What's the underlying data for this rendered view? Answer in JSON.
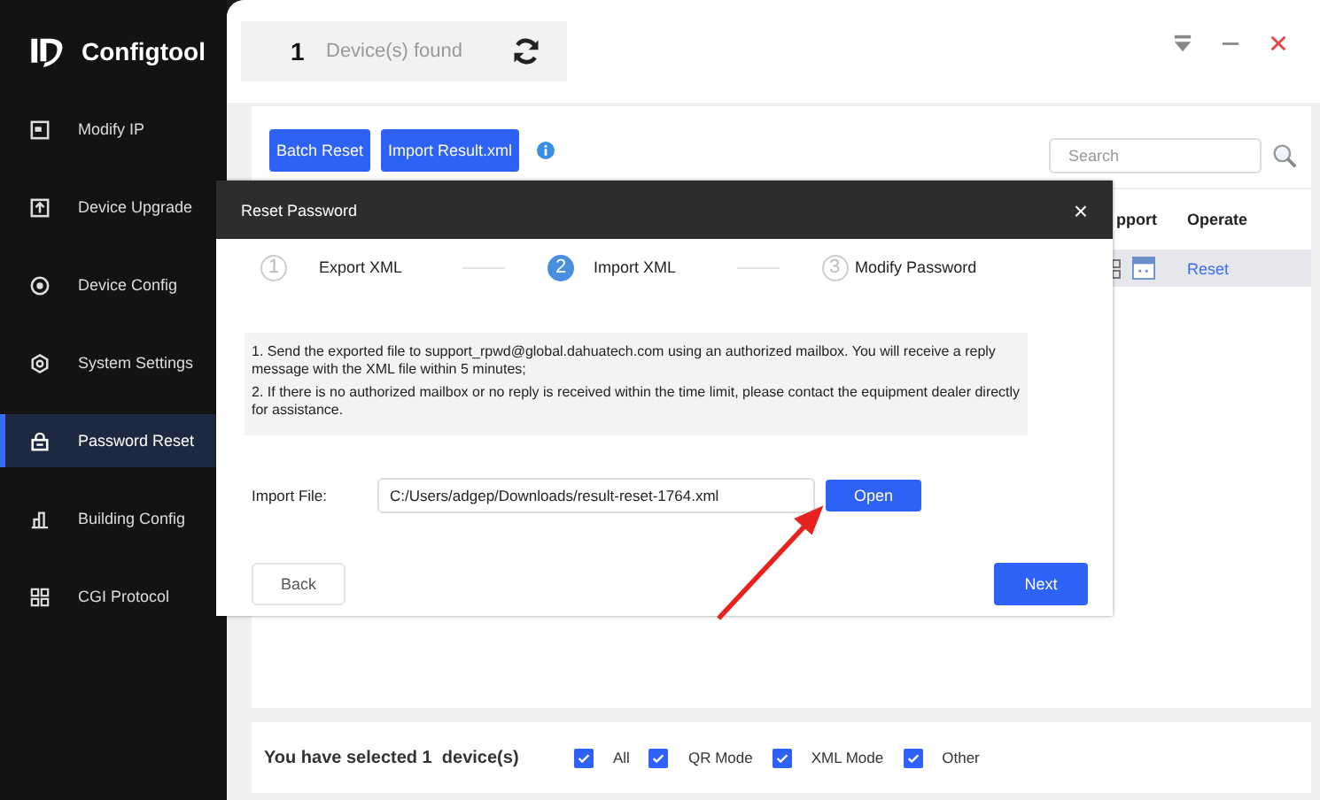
{
  "app": {
    "title": "Configtool"
  },
  "sidebar": {
    "items": [
      {
        "label": "Modify IP",
        "selected": false
      },
      {
        "label": "Device Upgrade",
        "selected": false
      },
      {
        "label": "Device Config",
        "selected": false
      },
      {
        "label": "System Settings",
        "selected": false
      },
      {
        "label": "Password Reset",
        "selected": true
      },
      {
        "label": "Building Config",
        "selected": false
      },
      {
        "label": "CGI Protocol",
        "selected": false
      }
    ]
  },
  "device_count": {
    "count": "1",
    "label": "Device(s) found"
  },
  "toolbar": {
    "buttons": [
      "Batch Reset",
      "Import Result.xml"
    ]
  },
  "search": {
    "placeholder": "Search"
  },
  "table": {
    "columns": [
      "pport",
      "Operate"
    ],
    "rows": [
      {
        "operate": "Reset",
        "selected": true
      }
    ]
  },
  "dialog": {
    "title": "Reset Password",
    "close": "×",
    "steps": [
      {
        "number": "1",
        "label": "Export XML",
        "selected": false
      },
      {
        "number": "2",
        "label": "Import XML",
        "selected": true
      },
      {
        "number": "3",
        "label": "Modify Password",
        "selected": false
      }
    ],
    "notes": [
      "1. Send the exported file to support_rpwd@global.dahuatech.com using an authorized mailbox. You will receive a reply message with the XML file within 5 minutes;",
      "2. If there is no authorized mailbox or no reply is received within the time limit, please contact the equipment dealer directly for assistance."
    ],
    "import_label": "Import File:",
    "import_value": "C:/Users/adgep/Downloads/result-reset-1764.xml",
    "open_button": "Open",
    "back_button": "Back",
    "next_button": "Next"
  },
  "footer": {
    "summary": "You have selected 1  device(s)",
    "filters": [
      {
        "label": "All",
        "checked": true
      },
      {
        "label": "QR Mode",
        "checked": true
      },
      {
        "label": "XML Mode",
        "checked": true
      },
      {
        "label": "Other",
        "checked": true
      }
    ]
  }
}
